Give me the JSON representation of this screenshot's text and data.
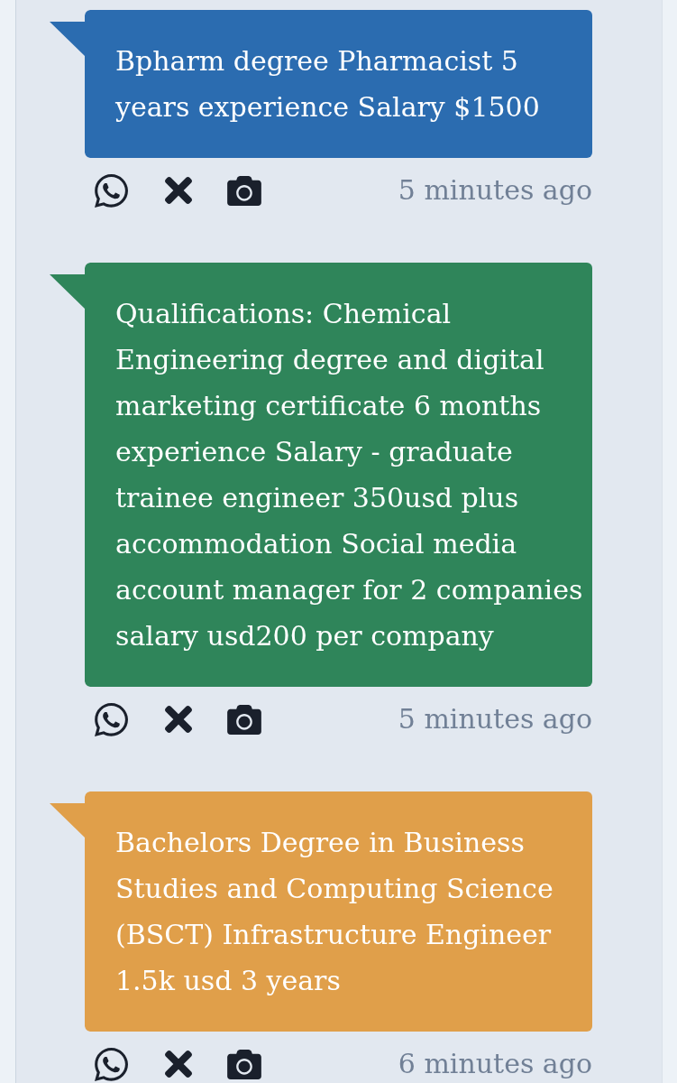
{
  "posts": [
    {
      "text": "Bpharm degree Pharmacist 5 years experience Salary $1500",
      "color": "#2b6cb0",
      "time": "5 minutes ago"
    },
    {
      "text": "Qualifications: Chemical Engineering degree and digital marketing certificate 6 months experience Salary - graduate trainee engineer 350usd plus accommodation Social media account manager for 2 companies salary usd200 per company",
      "color": "#2f855a",
      "time": "5 minutes ago"
    },
    {
      "text": "Bachelors Degree in Business Studies and Computing Science (BSCT) Infrastructure Engineer 1.5k usd 3 years",
      "color": "#e09f4a",
      "time": "6 minutes ago"
    }
  ]
}
